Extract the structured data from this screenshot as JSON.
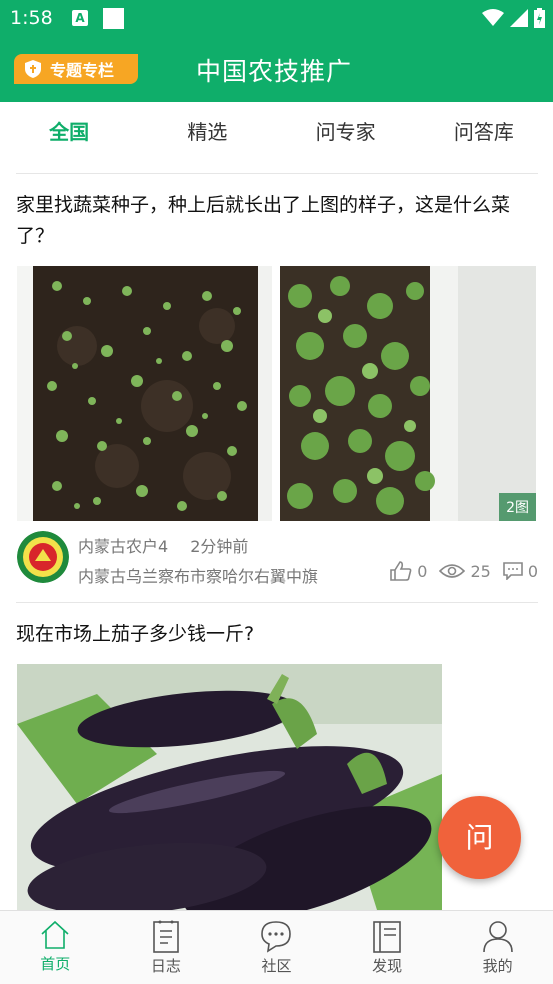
{
  "status_bar": {
    "time": "1:58",
    "a_label": "A"
  },
  "app_bar": {
    "topic_badge": "专题专栏",
    "title": "中国农技推广"
  },
  "tabs": [
    {
      "label": "全国",
      "active": true
    },
    {
      "label": "精选",
      "active": false
    },
    {
      "label": "问专家",
      "active": false
    },
    {
      "label": "问答库",
      "active": false
    }
  ],
  "posts": [
    {
      "title": "家里找蔬菜种子，种上后就长出了上图的样子，这是什么菜了？",
      "image_count": "2图",
      "author": "内蒙古农户4",
      "time_ago": "2分钟前",
      "location": "内蒙古乌兰察布市察哈尔右翼中旗",
      "likes": "0",
      "views": "25",
      "comments": "0"
    },
    {
      "title": "现在市场上茄子多少钱一斤?"
    }
  ],
  "fab": {
    "label": "问"
  },
  "bottom_nav": [
    {
      "label": "首页",
      "icon": "home-icon",
      "active": true
    },
    {
      "label": "日志",
      "icon": "log-icon",
      "active": false
    },
    {
      "label": "社区",
      "icon": "community-icon",
      "active": false
    },
    {
      "label": "发现",
      "icon": "discover-icon",
      "active": false
    },
    {
      "label": "我的",
      "icon": "profile-icon",
      "active": false
    }
  ],
  "colors": {
    "primary": "#0fae6a",
    "badge": "#f7a623",
    "fab": "#f0623b"
  }
}
